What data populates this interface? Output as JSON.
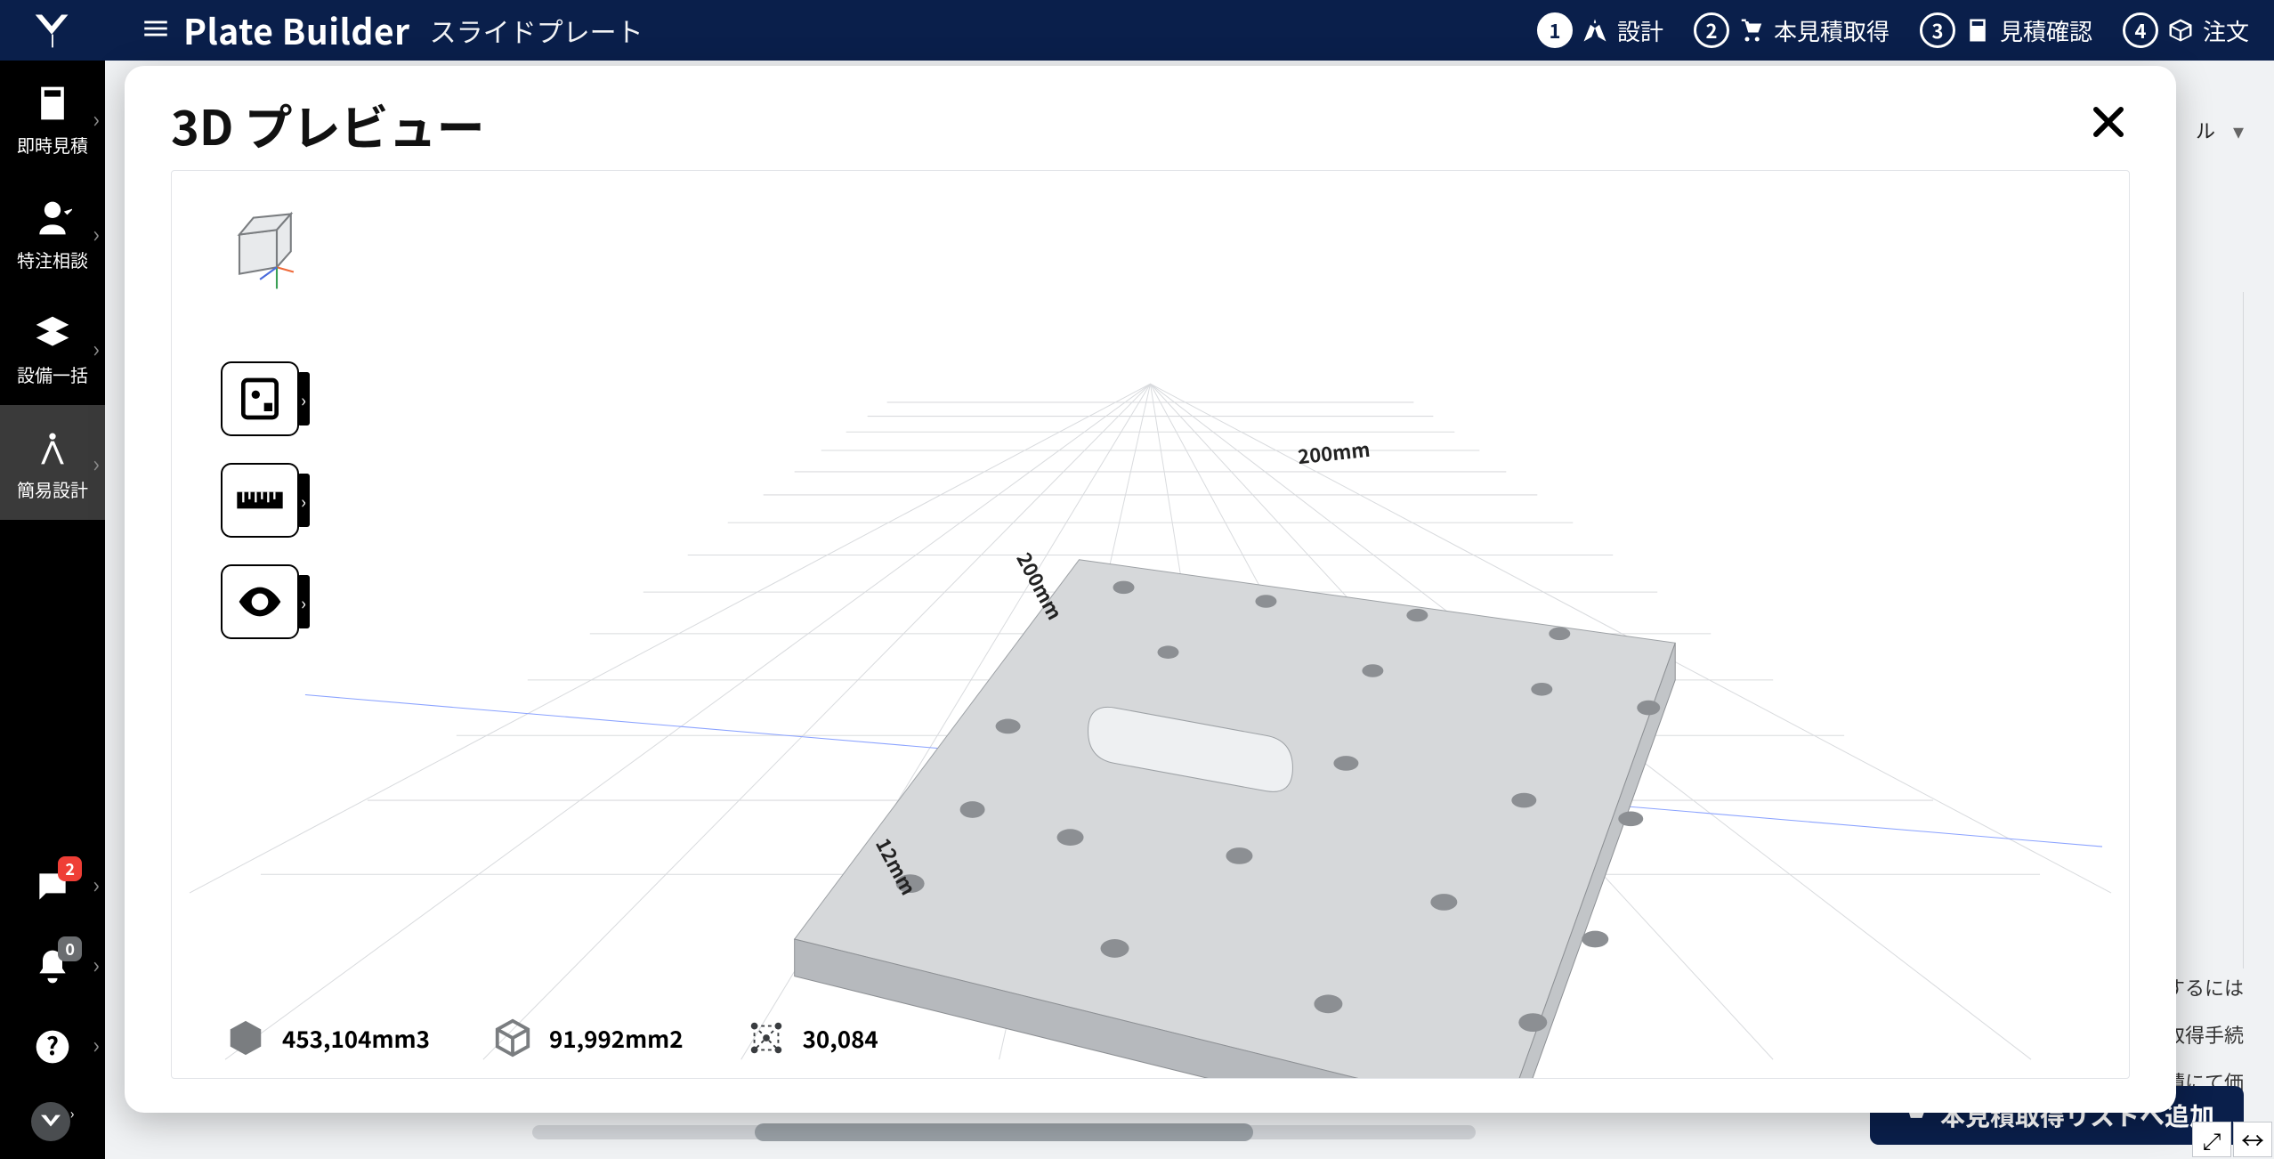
{
  "header": {
    "app_title": "Plate Builder",
    "sub_title": "スライドプレート",
    "steps": [
      {
        "num": "1",
        "label": "設計",
        "active": true
      },
      {
        "num": "2",
        "label": "本見積取得",
        "active": false
      },
      {
        "num": "3",
        "label": "見積確認",
        "active": false
      },
      {
        "num": "4",
        "label": "注文",
        "active": false
      }
    ]
  },
  "sidebar": {
    "items": [
      {
        "label": "即時見積"
      },
      {
        "label": "特注相談"
      },
      {
        "label": "設備一括"
      },
      {
        "label": "簡易設計"
      }
    ]
  },
  "sidebar_badges": {
    "chat": "2",
    "bell": "0"
  },
  "modal": {
    "title": "3D プレビュー",
    "dims": {
      "width": "200mm",
      "depth": "200mm",
      "height": "12mm"
    },
    "stats": {
      "volume": "453,104mm3",
      "surface": "91,992mm2",
      "faces": "30,084"
    }
  },
  "right": {
    "panel_label": "ル",
    "hints": [
      "得するには",
      "取得手続",
      "積にて価"
    ],
    "add_button": "本見積取得リストへ追加"
  }
}
